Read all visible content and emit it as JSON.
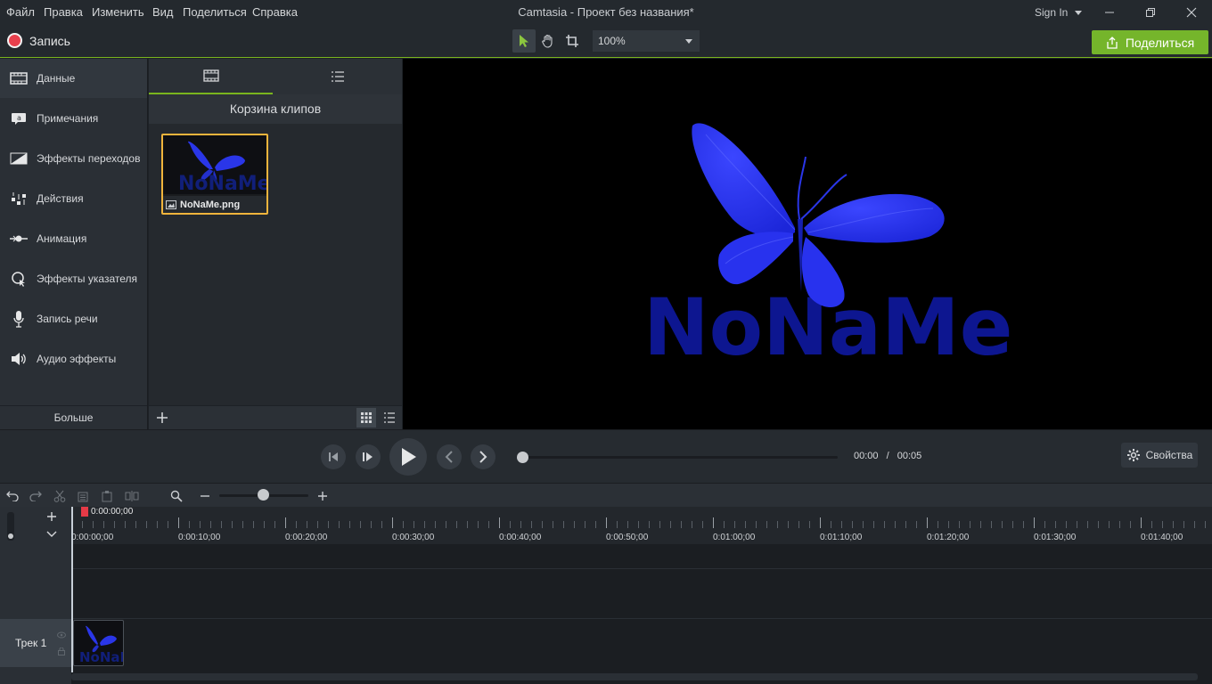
{
  "menu": {
    "items": [
      "Файл",
      "Правка",
      "Изменить",
      "Вид",
      "Поделиться",
      "Справка"
    ]
  },
  "window": {
    "title": "Camtasia - Проект без названия*",
    "sign_in": "Sign In"
  },
  "toolbar": {
    "record_label": "Запись",
    "zoom_value": "100%",
    "share_label": "Поделиться",
    "accent_color": "#7ab51d",
    "record_color": "#e8404d"
  },
  "sidebar": {
    "items": [
      {
        "label": "Данные",
        "icon": "media-film-icon"
      },
      {
        "label": "Примечания",
        "icon": "annotation-icon"
      },
      {
        "label": "Эффекты переходов",
        "icon": "transition-icon"
      },
      {
        "label": "Действия",
        "icon": "behaviors-icon"
      },
      {
        "label": "Анимация",
        "icon": "animation-icon"
      },
      {
        "label": "Эффекты указателя",
        "icon": "cursor-effects-icon"
      },
      {
        "label": "Запись речи",
        "icon": "microphone-icon"
      },
      {
        "label": "Аудио эффекты",
        "icon": "speaker-icon"
      }
    ],
    "more_label": "Больше"
  },
  "clip_bin": {
    "title": "Корзина клипов",
    "clips": [
      {
        "name": "NoNaMe.png"
      }
    ]
  },
  "canvas": {
    "logo_text": "NoNaMe"
  },
  "playback": {
    "current_time": "00:00",
    "separator": "/",
    "total_time": "00:05",
    "properties_label": "Свойства",
    "progress": 0
  },
  "timeline": {
    "playhead_time": "0:00:00;00",
    "ruler_labels": [
      "0:00:00;00",
      "0:00:10;00",
      "0:00:20;00",
      "0:00:30;00",
      "0:00:40;00",
      "0:00:50;00",
      "0:01:00;00",
      "0:01:10;00",
      "0:01:20;00",
      "0:01:30;00",
      "0:01:40;00"
    ],
    "track_label": "Трек 1",
    "zoom_level": 0.5
  }
}
